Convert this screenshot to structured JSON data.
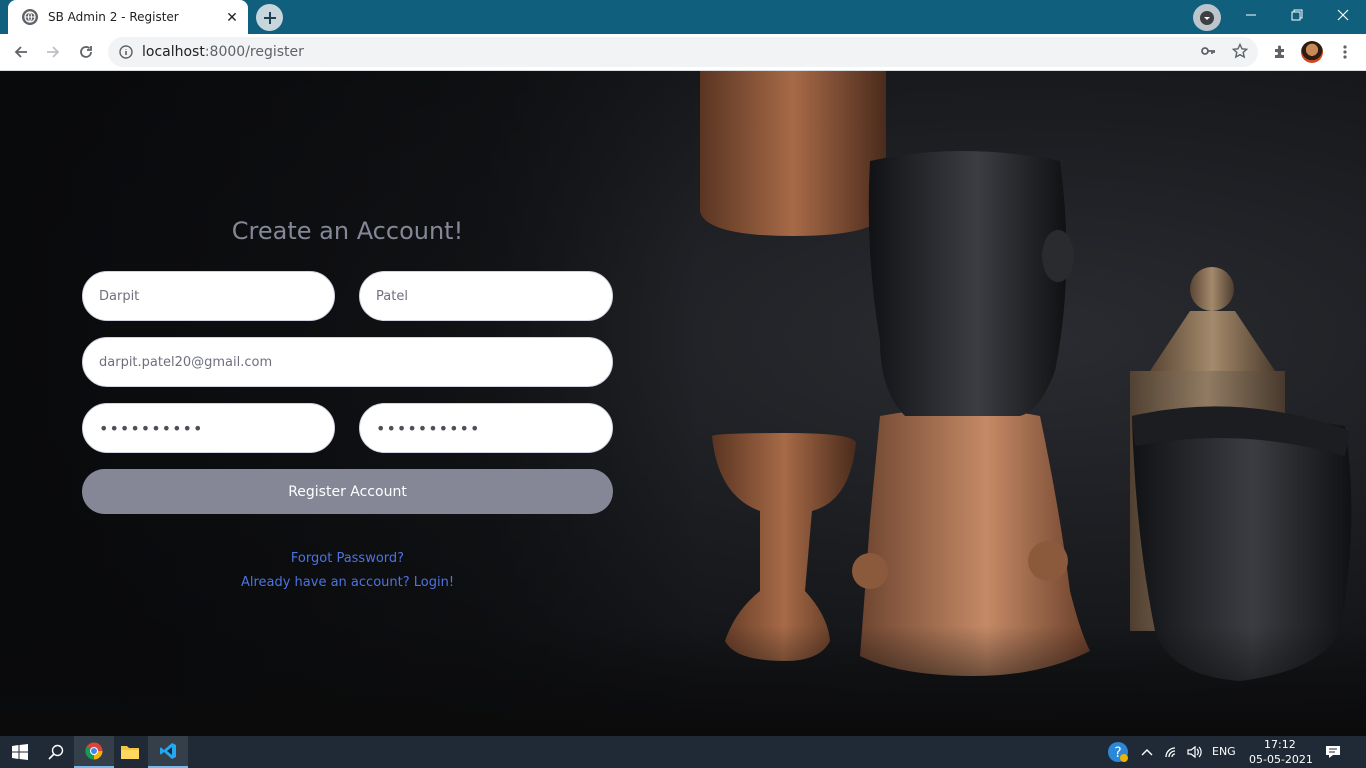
{
  "browser": {
    "tab_title": "SB Admin 2 - Register",
    "url_host": "localhost",
    "url_path": ":8000/register"
  },
  "page": {
    "heading": "Create an Account!",
    "first_name": "Darpit",
    "last_name": "Patel",
    "email": "darpit.patel20@gmail.com",
    "password": "••••••••••",
    "repeat_password": "••••••••••",
    "register_button": "Register Account",
    "forgot_link": "Forgot Password?",
    "login_link": "Already have an account? Login!"
  },
  "taskbar": {
    "language": "ENG",
    "time": "17:12",
    "date": "05-05-2021"
  },
  "colors": {
    "chrome_bar": "#0f5f7d",
    "button": "#858796",
    "link": "#4e73df"
  }
}
